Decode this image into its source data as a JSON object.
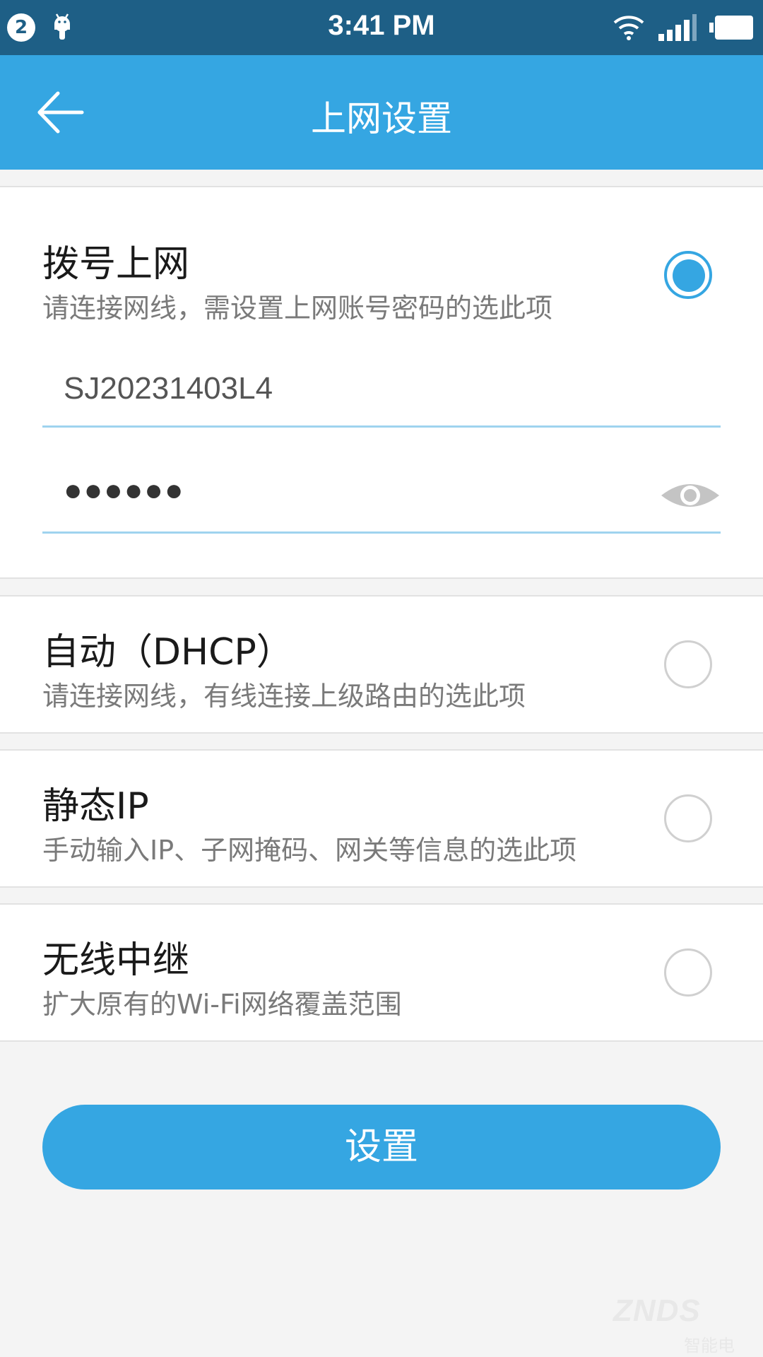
{
  "status_bar": {
    "notification_count": "2",
    "time": "3:41 PM",
    "icons": [
      "notification-badge",
      "android-icon",
      "wifi-icon",
      "signal-icon",
      "battery-icon"
    ]
  },
  "app_bar": {
    "title": "上网设置",
    "back_icon": "arrow-left-icon"
  },
  "options": [
    {
      "title": "拨号上网",
      "desc": "请连接网线，需设置上网账号密码的选此项",
      "selected": true,
      "account_value": "SJ20231403L4",
      "password_masked": "●●●●●●"
    },
    {
      "title": "自动（DHCP）",
      "desc": "请连接网线，有线连接上级路由的选此项",
      "selected": false
    },
    {
      "title": "静态IP",
      "desc": "手动输入IP、子网掩码、网关等信息的选此项",
      "selected": false
    },
    {
      "title": "无线中继",
      "desc": "扩大原有的Wi-Fi网络覆盖范围",
      "selected": false
    }
  ],
  "submit_label": "设置",
  "watermark": {
    "logo": "ZNDS",
    "cn": "智能电视网"
  },
  "colors": {
    "status_bar": "#1e5f86",
    "accent": "#35a6e2",
    "background": "#f4f4f4",
    "divider": "#e2e2e2",
    "field_underline": "#9fd3ef"
  }
}
